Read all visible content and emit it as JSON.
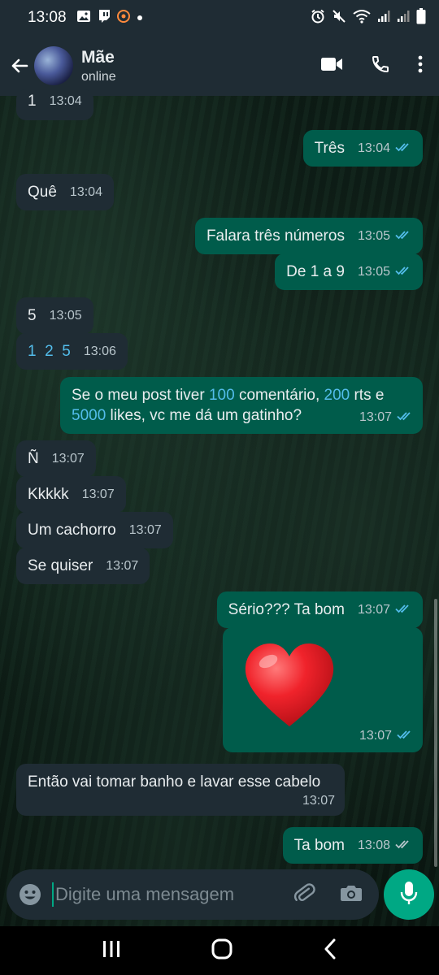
{
  "status_bar": {
    "time": "13:08",
    "icons": [
      "gallery-icon",
      "twitch-icon",
      "app-icon",
      "dot-icon",
      "alarm-icon",
      "mute-icon",
      "wifi-icon",
      "signal-icon",
      "signal-icon",
      "battery-icon"
    ]
  },
  "header": {
    "contact_name": "Mãe",
    "contact_status": "online"
  },
  "messages": [
    {
      "dir": "in",
      "text": "1",
      "time": "13:04"
    },
    {
      "dir": "out",
      "text": "Três",
      "time": "13:04",
      "read": true
    },
    {
      "dir": "in",
      "text": "Quê",
      "time": "13:04"
    },
    {
      "dir": "out",
      "text": "Falara três números",
      "time": "13:05",
      "read": true
    },
    {
      "dir": "out",
      "text": "De 1 a 9",
      "time": "13:05",
      "read": true
    },
    {
      "dir": "in",
      "text": "5",
      "time": "13:05"
    },
    {
      "dir": "in",
      "text": "1 2 5",
      "time": "13:06"
    },
    {
      "dir": "out",
      "text": "Se o meu post tiver 100 comentário, 200 rts e 5000 likes, vc me dá um gatinho?",
      "time": "13:07",
      "read": true
    },
    {
      "dir": "in",
      "text": "Ñ",
      "time": "13:07"
    },
    {
      "dir": "in",
      "text": "Kkkkk",
      "time": "13:07"
    },
    {
      "dir": "in",
      "text": "Um cachorro",
      "time": "13:07"
    },
    {
      "dir": "in",
      "text": "Se quiser",
      "time": "13:07"
    },
    {
      "dir": "out",
      "text": "Sério??? Ta bom",
      "time": "13:07",
      "read": true
    },
    {
      "dir": "out",
      "text": "❤️",
      "time": "13:07",
      "read": true,
      "emoji": "heart"
    },
    {
      "dir": "in",
      "text": "Então vai tomar banho e lavar esse cabelo",
      "time": "13:07"
    },
    {
      "dir": "out",
      "text": "Ta bom",
      "time": "13:08",
      "read": false
    }
  ],
  "msg8_parts": {
    "a": "Se o meu post tiver ",
    "n1": "100",
    "b": " comentário, ",
    "n2": "200",
    "c": " rts e",
    "n3": "5000",
    "d": " likes, vc me dá um gatinho?"
  },
  "msg7_parts": {
    "n1": "1",
    "n2": "2",
    "n3": "5"
  },
  "composer": {
    "placeholder": "Digite uma mensagem"
  },
  "colors": {
    "incoming_bubble": "#1f2c34",
    "outgoing_bubble": "#005c4b",
    "read_ticks": "#53bdeb",
    "accent": "#00a884"
  }
}
